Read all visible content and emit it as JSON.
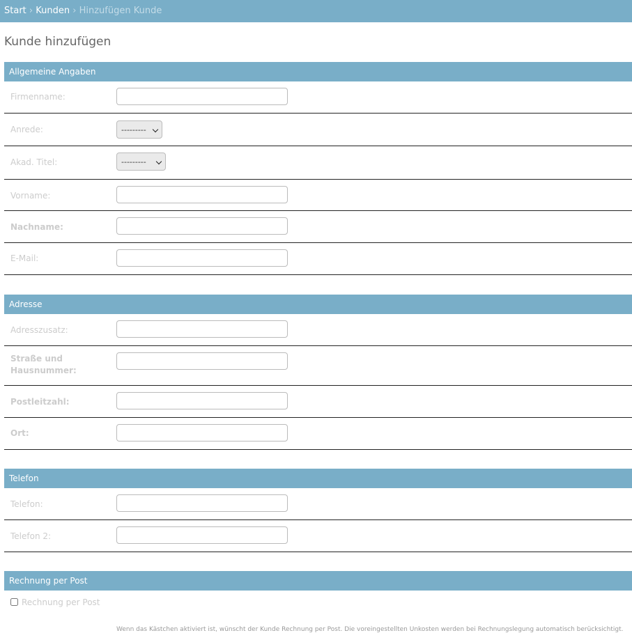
{
  "breadcrumbs": {
    "start": "Start",
    "kunden": "Kunden",
    "current": "Hinzufügen Kunde",
    "separator": "›"
  },
  "page_title": "Kunde hinzufügen",
  "sections": {
    "general": {
      "title": "Allgemeine Angaben",
      "firmenname_label": "Firmenname:",
      "anrede_label": "Anrede:",
      "anrede_value": "---------",
      "titel_label": "Akad. Titel:",
      "titel_value": "---------",
      "vorname_label": "Vorname:",
      "nachname_label": "Nachname:",
      "email_label": "E-Mail:"
    },
    "address": {
      "title": "Adresse",
      "adresszusatz_label": "Adresszusatz:",
      "strasse_label": "Straße und Hausnummer:",
      "plz_label": "Postleitzahl:",
      "ort_label": "Ort:"
    },
    "phone": {
      "title": "Telefon",
      "telefon_label": "Telefon:",
      "telefon2_label": "Telefon 2:"
    },
    "post": {
      "title": "Rechnung per Post",
      "checkbox_label": "Rechnung per Post",
      "help_text": "Wenn das Kästchen aktiviert ist, wünscht der Kunde Rechnung per Post. Die voreingestellten Unkosten werden bei Rechnungslegung automatisch berücksichtigt."
    }
  }
}
